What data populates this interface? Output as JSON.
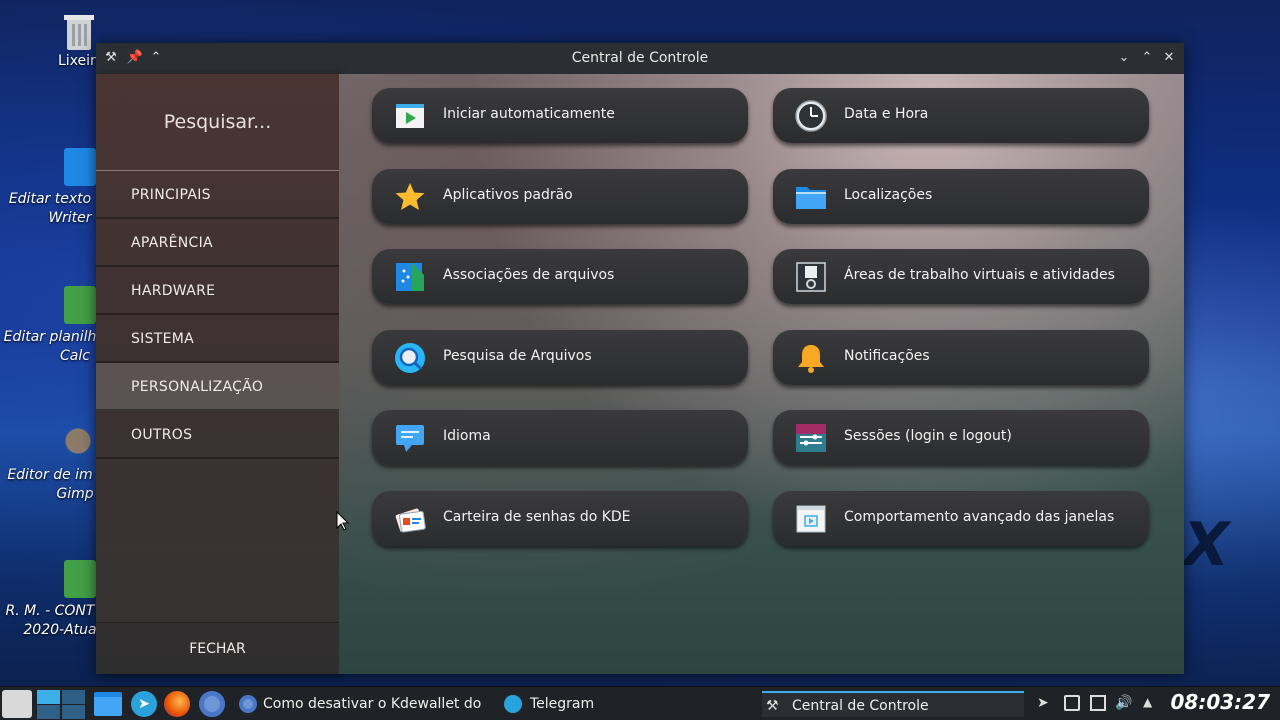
{
  "desktop": {
    "icons": [
      {
        "label": "Lixeira"
      },
      {
        "label_line1": "Editar texto",
        "label_line2": "Writer"
      },
      {
        "label_line1": "Editar planilh",
        "label_line2": "Calc"
      },
      {
        "label_line1": "Editor de im",
        "label_line2": "Gimp"
      },
      {
        "label_line1": "R. M. - CONT",
        "label_line2": "2020-Atua"
      }
    ],
    "watermark": "X"
  },
  "window": {
    "title": "Central de Controle",
    "search_placeholder": "Pesquisar...",
    "nav": [
      {
        "label": "PRINCIPAIS"
      },
      {
        "label": "APARÊNCIA"
      },
      {
        "label": "HARDWARE"
      },
      {
        "label": "SISTEMA"
      },
      {
        "label": "PERSONALIZAÇÃO",
        "active": true
      },
      {
        "label": "OUTROS"
      }
    ],
    "close_label": "FECHAR",
    "cards": [
      {
        "label": "Iniciar automaticamente",
        "icon": "autostart-icon"
      },
      {
        "label": "Data e Hora",
        "icon": "clock-icon"
      },
      {
        "label": "Aplicativos padrão",
        "icon": "star-icon"
      },
      {
        "label": "Localizações",
        "icon": "folder-icon"
      },
      {
        "label": "Associações de arquivos",
        "icon": "file-associations-icon"
      },
      {
        "label": "Áreas de trabalho virtuais e atividades",
        "icon": "virtual-desktops-icon"
      },
      {
        "label": "Pesquisa de Arquivos",
        "icon": "file-search-icon"
      },
      {
        "label": "Notificações",
        "icon": "bell-icon"
      },
      {
        "label": "Idioma",
        "icon": "language-icon"
      },
      {
        "label": "Sessões (login e logout)",
        "icon": "sessions-icon"
      },
      {
        "label": "Carteira de senhas do KDE",
        "icon": "wallet-icon"
      },
      {
        "label": "Comportamento avançado das janelas",
        "icon": "window-behavior-icon"
      }
    ]
  },
  "taskbar": {
    "tasks": [
      {
        "label": "Como desativar o Kdewallet do k..."
      },
      {
        "label": "Telegram"
      },
      {
        "label": "Central de Controle",
        "active": true
      }
    ],
    "clock": "08:03:27"
  },
  "colors": {
    "accent": "#3daee9",
    "card_bg": "#2f3031",
    "sidebar_bg": "#3e3232"
  }
}
